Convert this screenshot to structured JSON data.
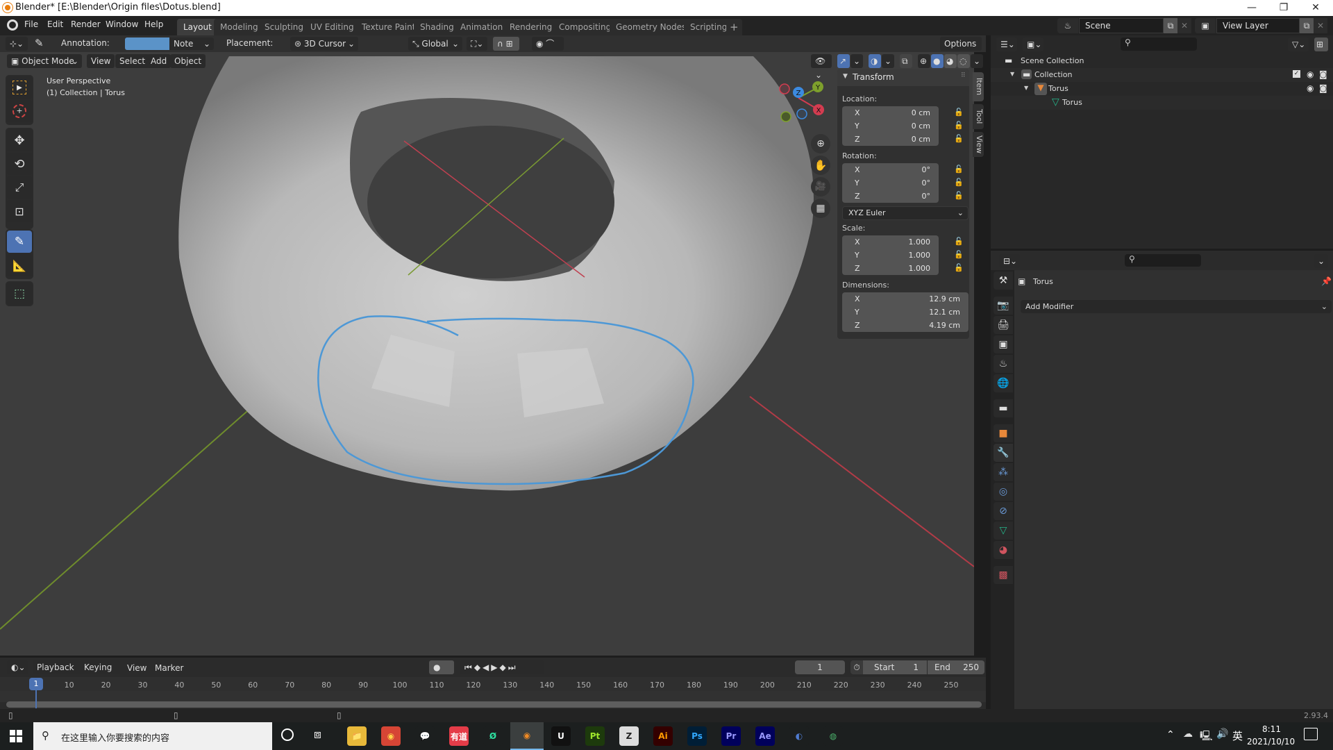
{
  "window": {
    "title": "Blender* [E:\\Blender\\Origin files\\Dotus.blend]",
    "controls": [
      "—",
      "❐",
      "✕"
    ]
  },
  "menu": [
    "File",
    "Edit",
    "Render",
    "Window",
    "Help"
  ],
  "workspaces": [
    {
      "label": "Layout",
      "active": true
    },
    {
      "label": "Modeling"
    },
    {
      "label": "Sculpting"
    },
    {
      "label": "UV Editing"
    },
    {
      "label": "Texture Paint"
    },
    {
      "label": "Shading"
    },
    {
      "label": "Animation"
    },
    {
      "label": "Rendering"
    },
    {
      "label": "Compositing"
    },
    {
      "label": "Geometry Nodes"
    },
    {
      "label": "Scripting"
    }
  ],
  "add_workspace": "+",
  "scene": {
    "label": "Scene",
    "view_layer": "View Layer"
  },
  "tool_header": {
    "annotation_label": "Annotation:",
    "annotation_color": "#5b93c8",
    "note_label": "Note",
    "placement_label": "Placement:",
    "placement_value": "3D Cursor",
    "orientation": "Global",
    "options": "Options"
  },
  "viewport_header": {
    "mode": "Object Mode",
    "menus": [
      "View",
      "Select",
      "Add",
      "Object"
    ]
  },
  "viewport": {
    "perspective": "User Perspective",
    "collection_info": "(1) Collection | Torus",
    "gizmo": {
      "x": "X",
      "y": "Y",
      "z": "Z"
    }
  },
  "toolbar": [
    "select-box",
    "cursor",
    "move",
    "rotate",
    "scale",
    "transform",
    "annotate",
    "measure",
    "add-cube"
  ],
  "npanel": {
    "title": "Transform",
    "tabs": [
      "Item",
      "Tool",
      "View"
    ],
    "location": {
      "label": "Location:",
      "x": "0 cm",
      "y": "0 cm",
      "z": "0 cm"
    },
    "rotation": {
      "label": "Rotation:",
      "x": "0°",
      "y": "0°",
      "z": "0°",
      "mode": "XYZ Euler"
    },
    "scale": {
      "label": "Scale:",
      "x": "1.000",
      "y": "1.000",
      "z": "1.000"
    },
    "dimensions": {
      "label": "Dimensions:",
      "x": "12.9 cm",
      "y": "12.1 cm",
      "z": "4.19 cm"
    },
    "axes": {
      "x": "X",
      "y": "Y",
      "z": "Z"
    }
  },
  "outliner": {
    "items": [
      {
        "label": "Scene Collection",
        "level": 0
      },
      {
        "label": "Collection",
        "level": 1
      },
      {
        "label": "Torus",
        "level": 2
      },
      {
        "label": "Torus",
        "level": 3
      }
    ]
  },
  "properties": {
    "object_name": "Torus",
    "add_modifier": "Add Modifier"
  },
  "timeline": {
    "menus": [
      "Playback",
      "Keying",
      "View",
      "Marker"
    ],
    "current_frame": "1",
    "start_label": "Start",
    "start": "1",
    "end_label": "End",
    "end": "250",
    "ticks": [
      "1",
      "10",
      "20",
      "30",
      "40",
      "50",
      "60",
      "70",
      "80",
      "90",
      "100",
      "110",
      "120",
      "130",
      "140",
      "150",
      "160",
      "170",
      "180",
      "190",
      "200",
      "210",
      "220",
      "230",
      "240",
      "250"
    ]
  },
  "status": {
    "version": "2.93.4"
  },
  "taskbar": {
    "search_placeholder": "在这里输入你要搜索的内容",
    "apps": [
      {
        "name": "file-explorer",
        "label": "📁",
        "bg": "#e8b93a",
        "color": "#2a6bd1"
      },
      {
        "name": "chrome",
        "label": "◉",
        "bg": "#d64535",
        "color": "#ffd64a"
      },
      {
        "name": "wechat",
        "label": "💬",
        "bg": "#1c1f1f",
        "color": "#2dc100"
      },
      {
        "name": "youdao",
        "label": "有道",
        "bg": "#e43c48",
        "color": "#fff"
      },
      {
        "name": "app-green",
        "label": "Ø",
        "bg": "#1c1f1f",
        "color": "#2ee2a2"
      },
      {
        "name": "blender",
        "label": "◉",
        "bg": "#3b3f3f",
        "color": "#f08a24"
      },
      {
        "name": "unreal",
        "label": "U",
        "bg": "#111",
        "color": "#fff"
      },
      {
        "name": "substance-painter",
        "label": "Pt",
        "bg": "#1d3a0c",
        "color": "#9fe72b"
      },
      {
        "name": "zbrush",
        "label": "Z",
        "bg": "#ddd",
        "color": "#222"
      },
      {
        "name": "illustrator",
        "label": "Ai",
        "bg": "#330000",
        "color": "#ff9a00"
      },
      {
        "name": "photoshop",
        "label": "Ps",
        "bg": "#001e36",
        "color": "#31a8ff"
      },
      {
        "name": "premiere",
        "label": "Pr",
        "bg": "#00005b",
        "color": "#9999ff"
      },
      {
        "name": "after-effects",
        "label": "Ae",
        "bg": "#00005b",
        "color": "#9999ff"
      },
      {
        "name": "cinema4d",
        "label": "◐",
        "bg": "#1c1f1f",
        "color": "#4f7bd0"
      },
      {
        "name": "app-globe",
        "label": "◍",
        "bg": "#1c1f1f",
        "color": "#4bb26b"
      }
    ],
    "tray": {
      "ime": "英",
      "time": "8:11",
      "date": "2021/10/10"
    }
  }
}
